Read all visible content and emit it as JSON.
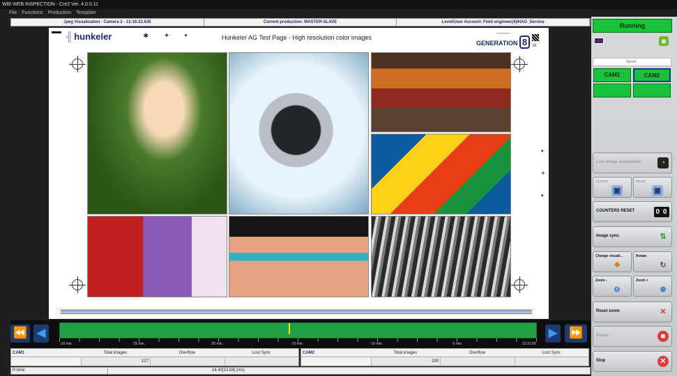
{
  "window": {
    "title": "WBI WEB INSPECTION - Cre2 Ver. 4.0.0.11"
  },
  "menu": [
    "File",
    "Functions",
    "Production",
    "Template"
  ],
  "infobar": {
    "visualization": "Jpeg Visualization - Camera 2 - 12:16:22.635",
    "production": "Current production: MASTER-SLAVE",
    "account": "Level/User Account: Field engineer(4)/HAG_Service"
  },
  "test_page": {
    "logo_mark": "╣",
    "logo": "hunkeler",
    "title": "Hunkeler AG Test Page - High resolution color images",
    "generation_brand": "Generation",
    "generation": "GENERATION",
    "generation_number": "8",
    "code": "06",
    "mini_marks": "∗ + •",
    "side_marks": [
      "•",
      "+",
      "•"
    ],
    "color_bars": [
      "#cfa514",
      "#27304d",
      "#5a9bd8",
      "#c43d3d"
    ]
  },
  "timeline": {
    "labels": [
      "-30 min.",
      "-25 min.",
      "-20 min.",
      "-15 min.",
      "-10 min.",
      "-5 min.",
      "12:31:58"
    ],
    "cursor_fraction": 0.48
  },
  "stats": {
    "cam1": {
      "name": "CAM1",
      "total_label": "Total images",
      "overflow_label": "Overflow",
      "lostsync_label": "Lost Sync",
      "total": "127",
      "overflow": "",
      "lostsync": ""
    },
    "cam2": {
      "name": "CAM2",
      "total_label": "Total images",
      "overflow_label": "Overflow",
      "lostsync_label": "Lost Sync",
      "total": "190",
      "overflow": "",
      "lostsync": ""
    },
    "ptime_label": "P-time:",
    "ptime_value": "24.40[13.84] (ms)"
  },
  "panel": {
    "status": "Running",
    "speed_label": "Speed :",
    "cam1": "CAM1",
    "cam2": "CAM2",
    "live_image_acquisition": "Live image acquisition",
    "mini_btn_1": "Current",
    "mini_btn_2": "Reset",
    "counters_reset": "COUNTERS RESET",
    "counter_value": "0 0",
    "image_sync": "Image sync.",
    "change_visual": "Change visuali...",
    "rotate": "Rotate",
    "zoom_minus": "Zoom -",
    "zoom_plus": "Zoom +",
    "reset_zoom": "Reset zoom",
    "pause": "Pause",
    "stop": "Stop"
  },
  "colors": {
    "running_green": "#19c23b",
    "nav_blue": "#3f9cf2",
    "timeline_green": "#20a244",
    "stop_red": "#e03a3a"
  }
}
